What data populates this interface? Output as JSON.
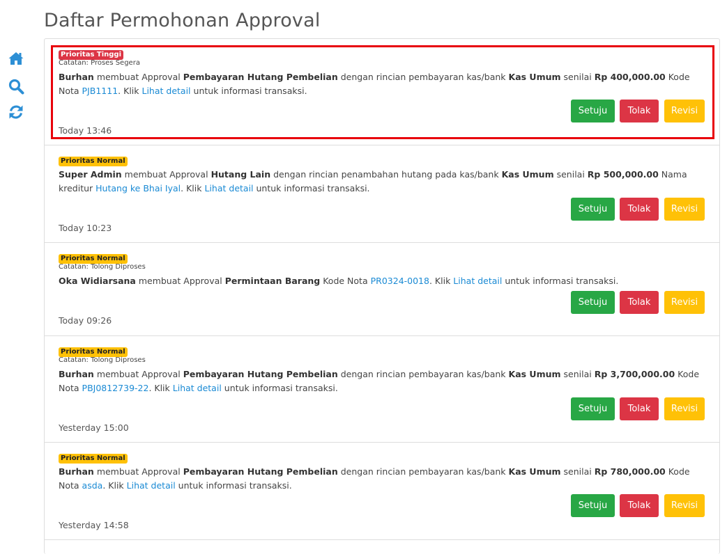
{
  "page": {
    "title": "Daftar Permohonan Approval"
  },
  "sidebar": {
    "icons": [
      "home-icon",
      "search-icon",
      "refresh-icon"
    ]
  },
  "colors": {
    "accent": "#1a8ad4",
    "approve": "#28a745",
    "reject": "#dc3545",
    "revise": "#ffc107",
    "highlight": "#e8000b"
  },
  "buttons": {
    "approve": "Setuju",
    "reject": "Tolak",
    "revise": "Revisi"
  },
  "common": {
    "klik": "Klik",
    "lihat_detail": "Lihat detail",
    "info_suffix": "untuk informasi transaksi."
  },
  "items": [
    {
      "priority": "Prioritas Tinggi",
      "note": "Catatan: Proses Segera",
      "actor": "Burhan",
      "verb": "membuat Approval",
      "type": "Pembayaran Hutang Pembelian",
      "detail_text": "dengan rincian pembayaran kas/bank",
      "account": "Kas Umum",
      "value_label": "senilai",
      "amount": "Rp 400,000.00",
      "ref_label": "Kode Nota",
      "ref": "PJB1111",
      "time": "Today 13:46"
    },
    {
      "priority": "Prioritas Normal",
      "actor": "Super Admin",
      "verb": "membuat Approval",
      "type": "Hutang Lain",
      "detail_text": "dengan rincian penambahan hutang pada kas/bank",
      "account": "Kas Umum",
      "value_label": "senilai",
      "amount": "Rp 500,000.00",
      "ref_label": "Nama kreditur",
      "ref": "Hutang ke Bhai Iyal",
      "time": "Today 10:23"
    },
    {
      "priority": "Prioritas Normal",
      "note": "Catatan: Tolong Diproses",
      "actor": "Oka Widiarsana",
      "verb": "membuat Approval",
      "type": "Permintaan Barang",
      "ref_label": "Kode Nota",
      "ref": "PR0324-0018",
      "time": "Today 09:26"
    },
    {
      "priority": "Prioritas Normal",
      "note": "Catatan: Tolong Diproses",
      "actor": "Burhan",
      "verb": "membuat Approval",
      "type": "Pembayaran Hutang Pembelian",
      "detail_text": "dengan rincian pembayaran kas/bank",
      "account": "Kas Umum",
      "value_label": "senilai",
      "amount": "Rp 3,700,000.00",
      "ref_label": "Kode Nota",
      "ref": "PBJ0812739-22",
      "time": "Yesterday 15:00"
    },
    {
      "priority": "Prioritas Normal",
      "actor": "Burhan",
      "verb": "membuat Approval",
      "type": "Pembayaran Hutang Pembelian",
      "detail_text": "dengan rincian pembayaran kas/bank",
      "account": "Kas Umum",
      "value_label": "senilai",
      "amount": "Rp 780,000.00",
      "ref_label": "Kode Nota",
      "ref": "asda",
      "time": "Yesterday 14:58"
    }
  ]
}
